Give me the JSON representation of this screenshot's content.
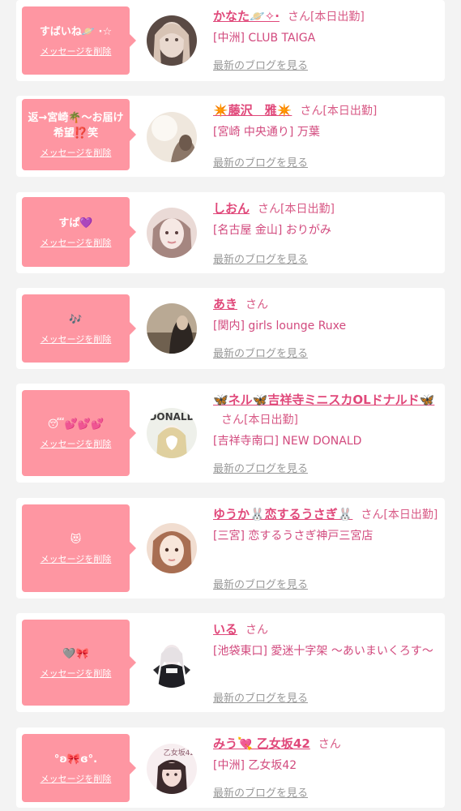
{
  "delete_label": "メッセージを削除",
  "blog_label": "最新のブログを見る",
  "cards": [
    {
      "message": "すばいね🪐 ·☆",
      "name": "かなた🪐✧·",
      "san": "さん[本日出勤]",
      "shop": "[中洲] CLUB TAIGA",
      "avatar_colors": [
        "#e9d9cf",
        "#b89e92",
        "#5a4a44"
      ]
    },
    {
      "message": "返→宮崎🌴〜お届け希望⁉️笑",
      "name": "✴️藤沢　雅✴️",
      "san": "さん[本日出勤]",
      "shop": "[宮崎 中央通り] 万葉",
      "avatar_colors": [
        "#f6f1ea",
        "#ddd0c2",
        "#8c7768"
      ]
    },
    {
      "message": "すぱ💜",
      "name": "しおん",
      "san": "さん[本日出勤]",
      "shop": "[名古屋 金山] おりがみ",
      "avatar_colors": [
        "#f4e7e5",
        "#e5c7c3",
        "#8b6a6a"
      ]
    },
    {
      "message": "🎶",
      "name": "あき",
      "san": "さん",
      "shop": "[関内] girls lounge Ruxe",
      "avatar_colors": [
        "#d4c8b8",
        "#8d7a66",
        "#352c26"
      ]
    },
    {
      "message": "😴💕💕💕",
      "name": "🦋ネル🦋吉祥寺ミニスカOLドナルド🦋",
      "san": "さん[本日出勤]",
      "shop": "[吉祥寺南口] NEW DONALD",
      "avatar_colors": [
        "#f1efe6",
        "#d4cdb2",
        "#bfa660"
      ]
    },
    {
      "message": "😻",
      "name": "ゆうか🐰恋するうさぎ🐰",
      "san": "さん[本日出勤]",
      "shop": "[三宮] 恋するうさぎ神戸三宮店",
      "avatar_colors": [
        "#f6e3d6",
        "#d9a98c",
        "#7b4f3c"
      ]
    },
    {
      "message": "🩶🎀",
      "name": "いる",
      "san": "さん",
      "shop": "[池袋東口] 愛迷十字架 〜あいまいくろす〜",
      "avatar_colors": [
        "#f5f5f5",
        "#e0dde0",
        "#2a2a2e"
      ]
    },
    {
      "message": "°ʚ🎀ɞ°.",
      "name": "みう💘 乙女坂42",
      "san": "さん",
      "shop": "[中洲] 乙女坂42",
      "avatar_colors": [
        "#f7eef0",
        "#c9a7a8",
        "#3c2a2c"
      ]
    }
  ]
}
